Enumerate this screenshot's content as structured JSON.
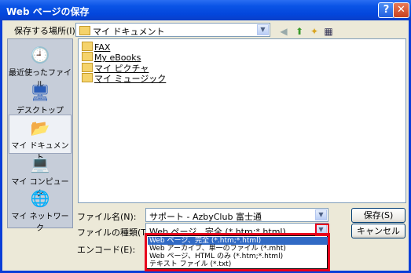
{
  "window": {
    "title": "Web ページの保存",
    "help_label": "?",
    "close_label": "✕"
  },
  "save_in": {
    "label": "保存する場所(I):",
    "value": "マイ ドキュメント"
  },
  "places": [
    {
      "label": "最近使ったファイル",
      "icon": "recent-documents-icon"
    },
    {
      "label": "デスクトップ",
      "icon": "desktop-icon"
    },
    {
      "label": "マイ ドキュメント",
      "icon": "my-documents-icon"
    },
    {
      "label": "マイ コンピュータ",
      "icon": "my-computer-icon"
    },
    {
      "label": "マイ ネットワーク",
      "icon": "my-network-icon"
    }
  ],
  "files": [
    {
      "name": "FAX"
    },
    {
      "name": "My eBooks"
    },
    {
      "name": "マイ ピクチャ"
    },
    {
      "name": "マイ ミュージック"
    }
  ],
  "filename": {
    "label": "ファイル名(N):",
    "value": "サポート - AzbyClub 富士通"
  },
  "filetype": {
    "label": "ファイルの種類(T):",
    "value": "Web ページ、完全 (*.htm;*.html)",
    "options": [
      "Web ページ、完全 (*.htm;*.html)",
      "Web アーカイブ、単一のファイル (*.mht)",
      "Web ページ、HTML のみ (*.htm;*.html)",
      "テキスト ファイル (*.txt)"
    ]
  },
  "encoding": {
    "label": "エンコード(E):"
  },
  "buttons": {
    "save": "保存(S)",
    "cancel": "キャンセル"
  },
  "colors": {
    "highlight": "#e8001c",
    "selection": "#316ac5",
    "titlebar": "#0a54e6"
  }
}
